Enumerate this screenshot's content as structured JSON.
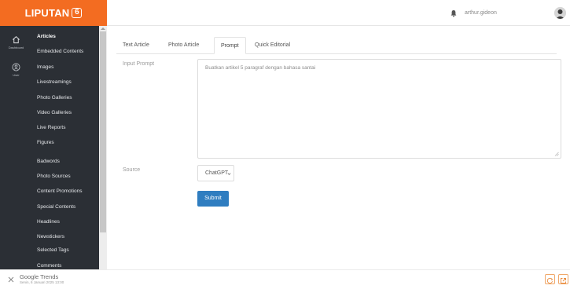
{
  "brand": {
    "logo_text": "LIPUTAN",
    "logo_badge": "6"
  },
  "rail": [
    {
      "label": "Dashboard",
      "icon": "home-icon"
    },
    {
      "label": "User",
      "icon": "user-icon"
    }
  ],
  "menu": {
    "items": [
      {
        "label": "Articles",
        "bold": true
      },
      {
        "label": "Embedded Contents"
      },
      {
        "label": "Images"
      },
      {
        "label": "Livestreamings"
      },
      {
        "label": "Photo Galleries"
      },
      {
        "label": "Video Galleries"
      },
      {
        "label": "Live Reports"
      },
      {
        "label": "Figures"
      },
      {
        "label": "Badwords"
      },
      {
        "label": "Photo Sources"
      },
      {
        "label": "Content Promotions"
      },
      {
        "label": "Special Contents"
      },
      {
        "label": "Headlines"
      },
      {
        "label": "Newstickers"
      },
      {
        "label": "Selected Tags"
      },
      {
        "label": "Comments"
      }
    ]
  },
  "header": {
    "username": "arthur.gideon"
  },
  "tabs": [
    {
      "label": "Text Article"
    },
    {
      "label": "Photo Article"
    },
    {
      "label": "Prompt",
      "active": true
    },
    {
      "label": "Quick Editorial"
    }
  ],
  "form": {
    "prompt_label": "Input Prompt",
    "prompt_value": "Buatkan artikel 5 paragraf dengan bahasa santai",
    "source_label": "Source",
    "source_value": "ChatGPT",
    "submit_label": "Submit"
  },
  "notification": {
    "title": "Google Trends",
    "time": "Senin, 6 Januari 2025 13:00"
  },
  "colors": {
    "brand": "#f36c21",
    "sidebar": "#2b2f35",
    "primary_button": "#2f7dc0"
  }
}
